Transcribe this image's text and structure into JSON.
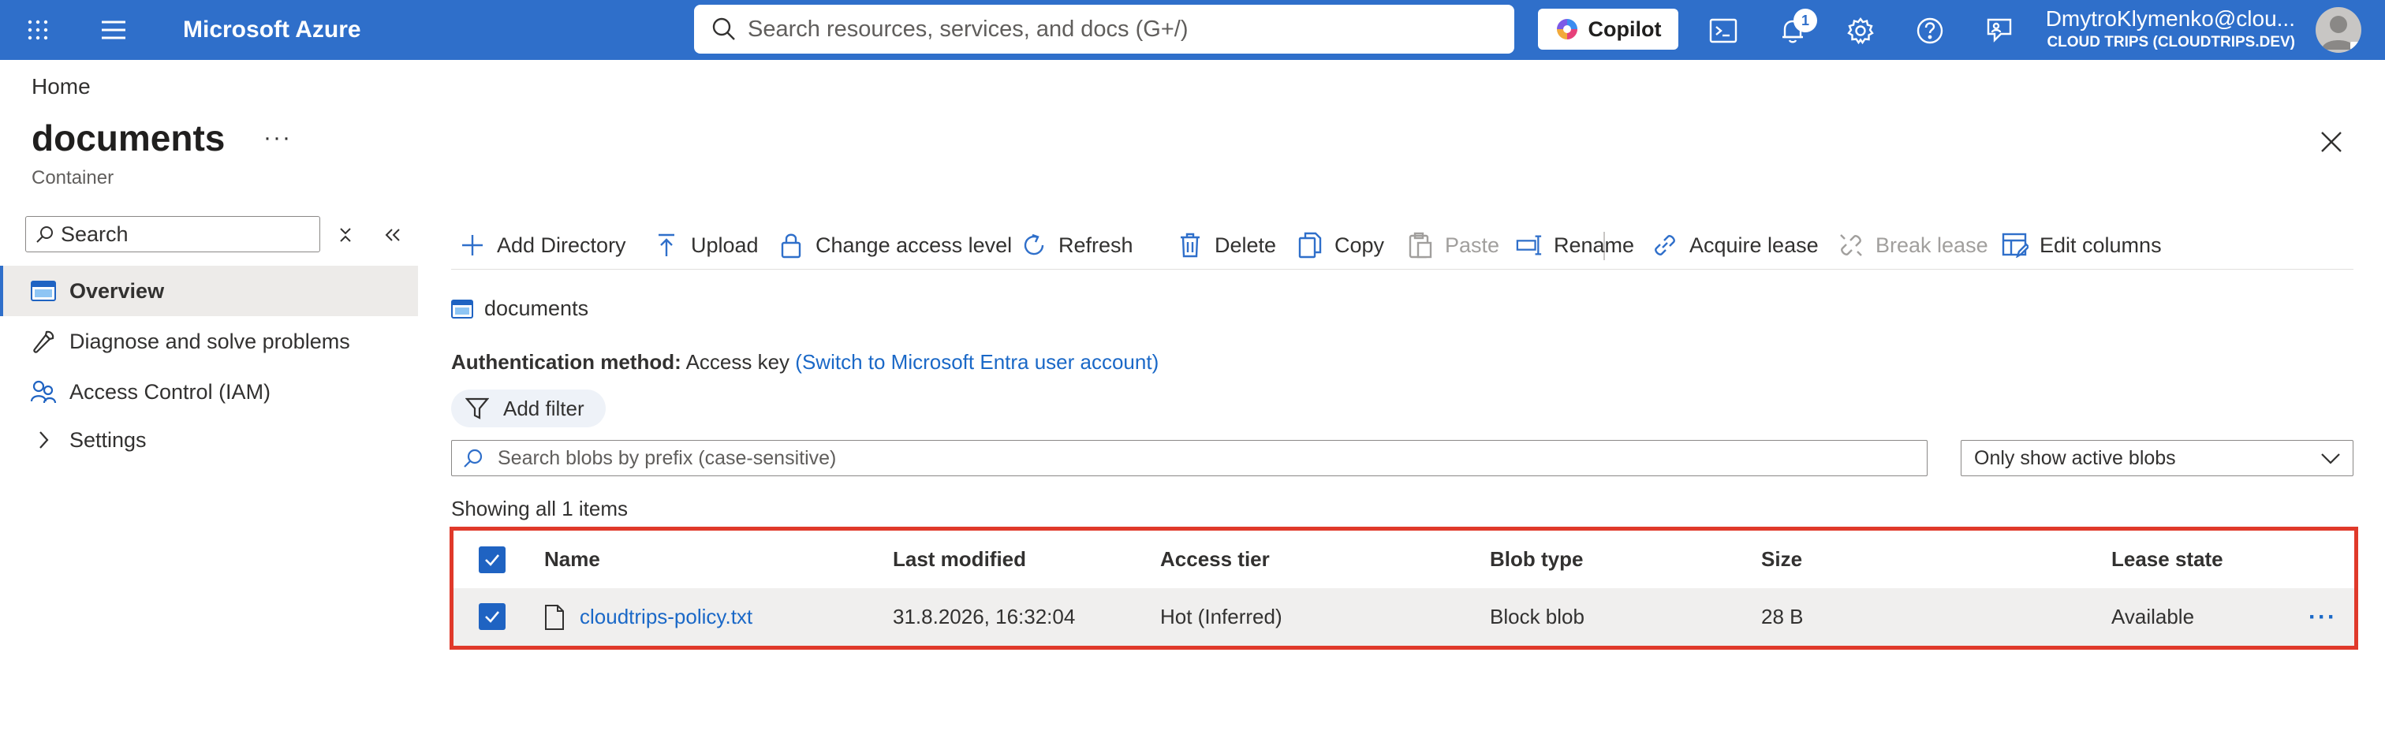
{
  "topbar": {
    "brand": "Microsoft Azure",
    "search_placeholder": "Search resources, services, and docs (G+/)",
    "copilot_label": "Copilot",
    "notification_count": "1",
    "account_name": "DmytroKlymenko@clou...",
    "account_tenant": "CLOUD TRIPS (CLOUDTRIPS.DEV)",
    "accent_color": "#2f6fca"
  },
  "header": {
    "breadcrumb": "Home",
    "title": "documents",
    "more": "···",
    "subtitle": "Container"
  },
  "nav": {
    "search_placeholder": "Search",
    "items": [
      {
        "label": "Overview",
        "icon": "container-icon",
        "active": true
      },
      {
        "label": "Diagnose and solve problems",
        "icon": "wrench-icon"
      },
      {
        "label": "Access Control (IAM)",
        "icon": "people-icon"
      },
      {
        "label": "Settings",
        "icon": "chevron-right-icon"
      }
    ]
  },
  "toolbar": {
    "add_directory": "Add Directory",
    "upload": "Upload",
    "change_access": "Change access level",
    "refresh": "Refresh",
    "delete": "Delete",
    "copy": "Copy",
    "paste": "Paste",
    "rename": "Rename",
    "acquire_lease": "Acquire lease",
    "break_lease": "Break lease",
    "edit_columns": "Edit columns"
  },
  "content": {
    "path_label": "documents",
    "auth_label": "Authentication method:",
    "auth_value": "Access key",
    "auth_link": "(Switch to Microsoft Entra user account)",
    "filter_label": "Add filter",
    "blob_search_placeholder": "Search blobs by prefix (case-sensitive)",
    "blob_filter_value": "Only show active blobs",
    "count_text": "Showing all 1 items"
  },
  "grid": {
    "columns": {
      "name": "Name",
      "modified": "Last modified",
      "tier": "Access tier",
      "type": "Blob type",
      "size": "Size",
      "lease": "Lease state"
    },
    "rows": [
      {
        "name": "cloudtrips-policy.txt",
        "modified": "31.8.2026, 16:32:04",
        "tier": "Hot (Inferred)",
        "type": "Block blob",
        "size": "28 B",
        "lease": "Available",
        "more": "···",
        "selected": true
      }
    ],
    "highlight_color": "#e0392a"
  }
}
